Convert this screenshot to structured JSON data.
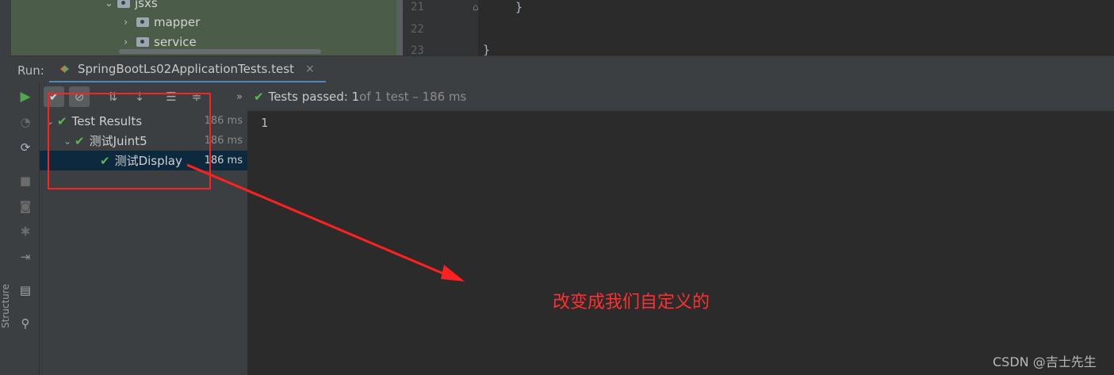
{
  "project_tree": {
    "items": [
      {
        "label": "jsxs",
        "expanded": true
      },
      {
        "label": "mapper",
        "expanded": false
      },
      {
        "label": "service",
        "expanded": false
      }
    ]
  },
  "editor": {
    "lines": [
      {
        "number": "21",
        "code": "}"
      },
      {
        "number": "22",
        "code": ""
      },
      {
        "number": "23",
        "code": "}"
      }
    ]
  },
  "run_panel": {
    "label": "Run:",
    "tab_title": "SpringBootLs02ApplicationTests.test",
    "tab_close": "×",
    "status_icon": "double-chevron-icon",
    "status_bold": "Tests passed: 1",
    "status_rest": " of 1 test – 186 ms",
    "side_label": "Structure"
  },
  "test_tree": {
    "rows": [
      {
        "label": "Test Results",
        "duration": "186 ms",
        "selected": false
      },
      {
        "label": "测试Juint5",
        "duration": "186 ms",
        "selected": false
      },
      {
        "label": "测试Display",
        "duration": "186 ms",
        "selected": true
      }
    ]
  },
  "console": {
    "output": "1"
  },
  "annotation": {
    "text": "改变成我们自定义的",
    "color": "#ff2020"
  },
  "watermark": "CSDN @吉士先生"
}
